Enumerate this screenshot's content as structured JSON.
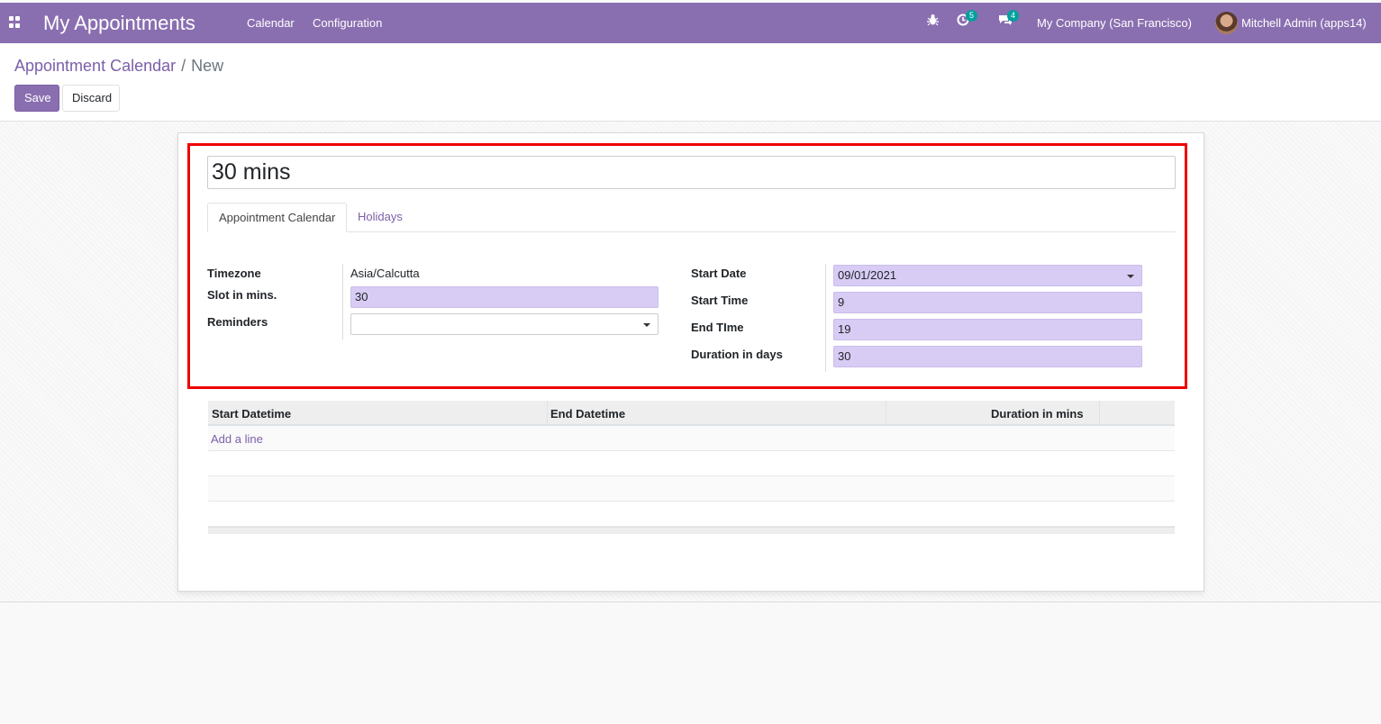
{
  "app": {
    "title": "My Appointments"
  },
  "nav": {
    "calendar": "Calendar",
    "configuration": "Configuration"
  },
  "systray": {
    "debug_icon": "bug-icon",
    "activity_count": "5",
    "messages_count": "4",
    "company": "My Company (San Francisco)",
    "user": "Mitchell Admin (apps14)"
  },
  "breadcrumb": {
    "parent": "Appointment Calendar",
    "separator": "/",
    "current": "New"
  },
  "buttons": {
    "save": "Save",
    "discard": "Discard"
  },
  "form": {
    "name": "30 mins",
    "tabs": [
      {
        "label": "Appointment Calendar",
        "active": true
      },
      {
        "label": "Holidays",
        "active": false
      }
    ],
    "left": {
      "timezone_label": "Timezone",
      "timezone_value": "Asia/Calcutta",
      "slot_label": "Slot in mins.",
      "slot_value": "30",
      "reminders_label": "Reminders",
      "reminders_value": ""
    },
    "right": {
      "start_date_label": "Start Date",
      "start_date_value": "09/01/2021",
      "start_time_label": "Start Time",
      "start_time_value": "9",
      "end_time_label": "End TIme",
      "end_time_value": "19",
      "duration_label": "Duration in days",
      "duration_value": "30"
    }
  },
  "table": {
    "columns": [
      "Start Datetime",
      "End Datetime",
      "Duration in mins"
    ],
    "add_line": "Add a line"
  },
  "colors": {
    "brand": "#8a6fb0",
    "accent": "#7c5fa8",
    "required_field": "#d8ccf5",
    "highlight": "#e00000"
  }
}
